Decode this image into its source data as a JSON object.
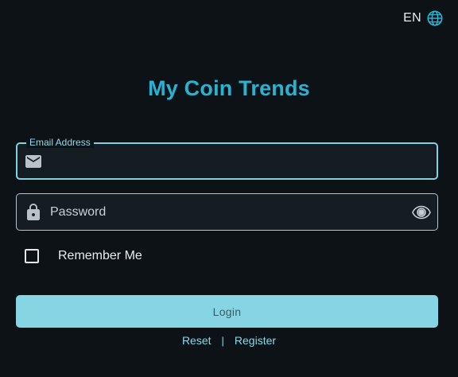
{
  "language": {
    "label": "EN",
    "icon": "globe-icon"
  },
  "app": {
    "title": "My Coin Trends"
  },
  "form": {
    "email": {
      "label": "Email Address",
      "value": "",
      "placeholder": "",
      "icon": "mail-icon"
    },
    "password": {
      "label": "Password",
      "value": "",
      "placeholder": "Password",
      "icon": "lock-icon",
      "toggle_icon": "eye-icon"
    },
    "remember_me": {
      "label": "Remember Me",
      "checked": false
    },
    "login_button": "Login"
  },
  "links": {
    "reset": "Reset",
    "separator": "|",
    "register": "Register"
  },
  "colors": {
    "background": "#0d1216",
    "accent": "#27b3d3",
    "button": "#86d5e5",
    "link": "#8ad8e8"
  }
}
